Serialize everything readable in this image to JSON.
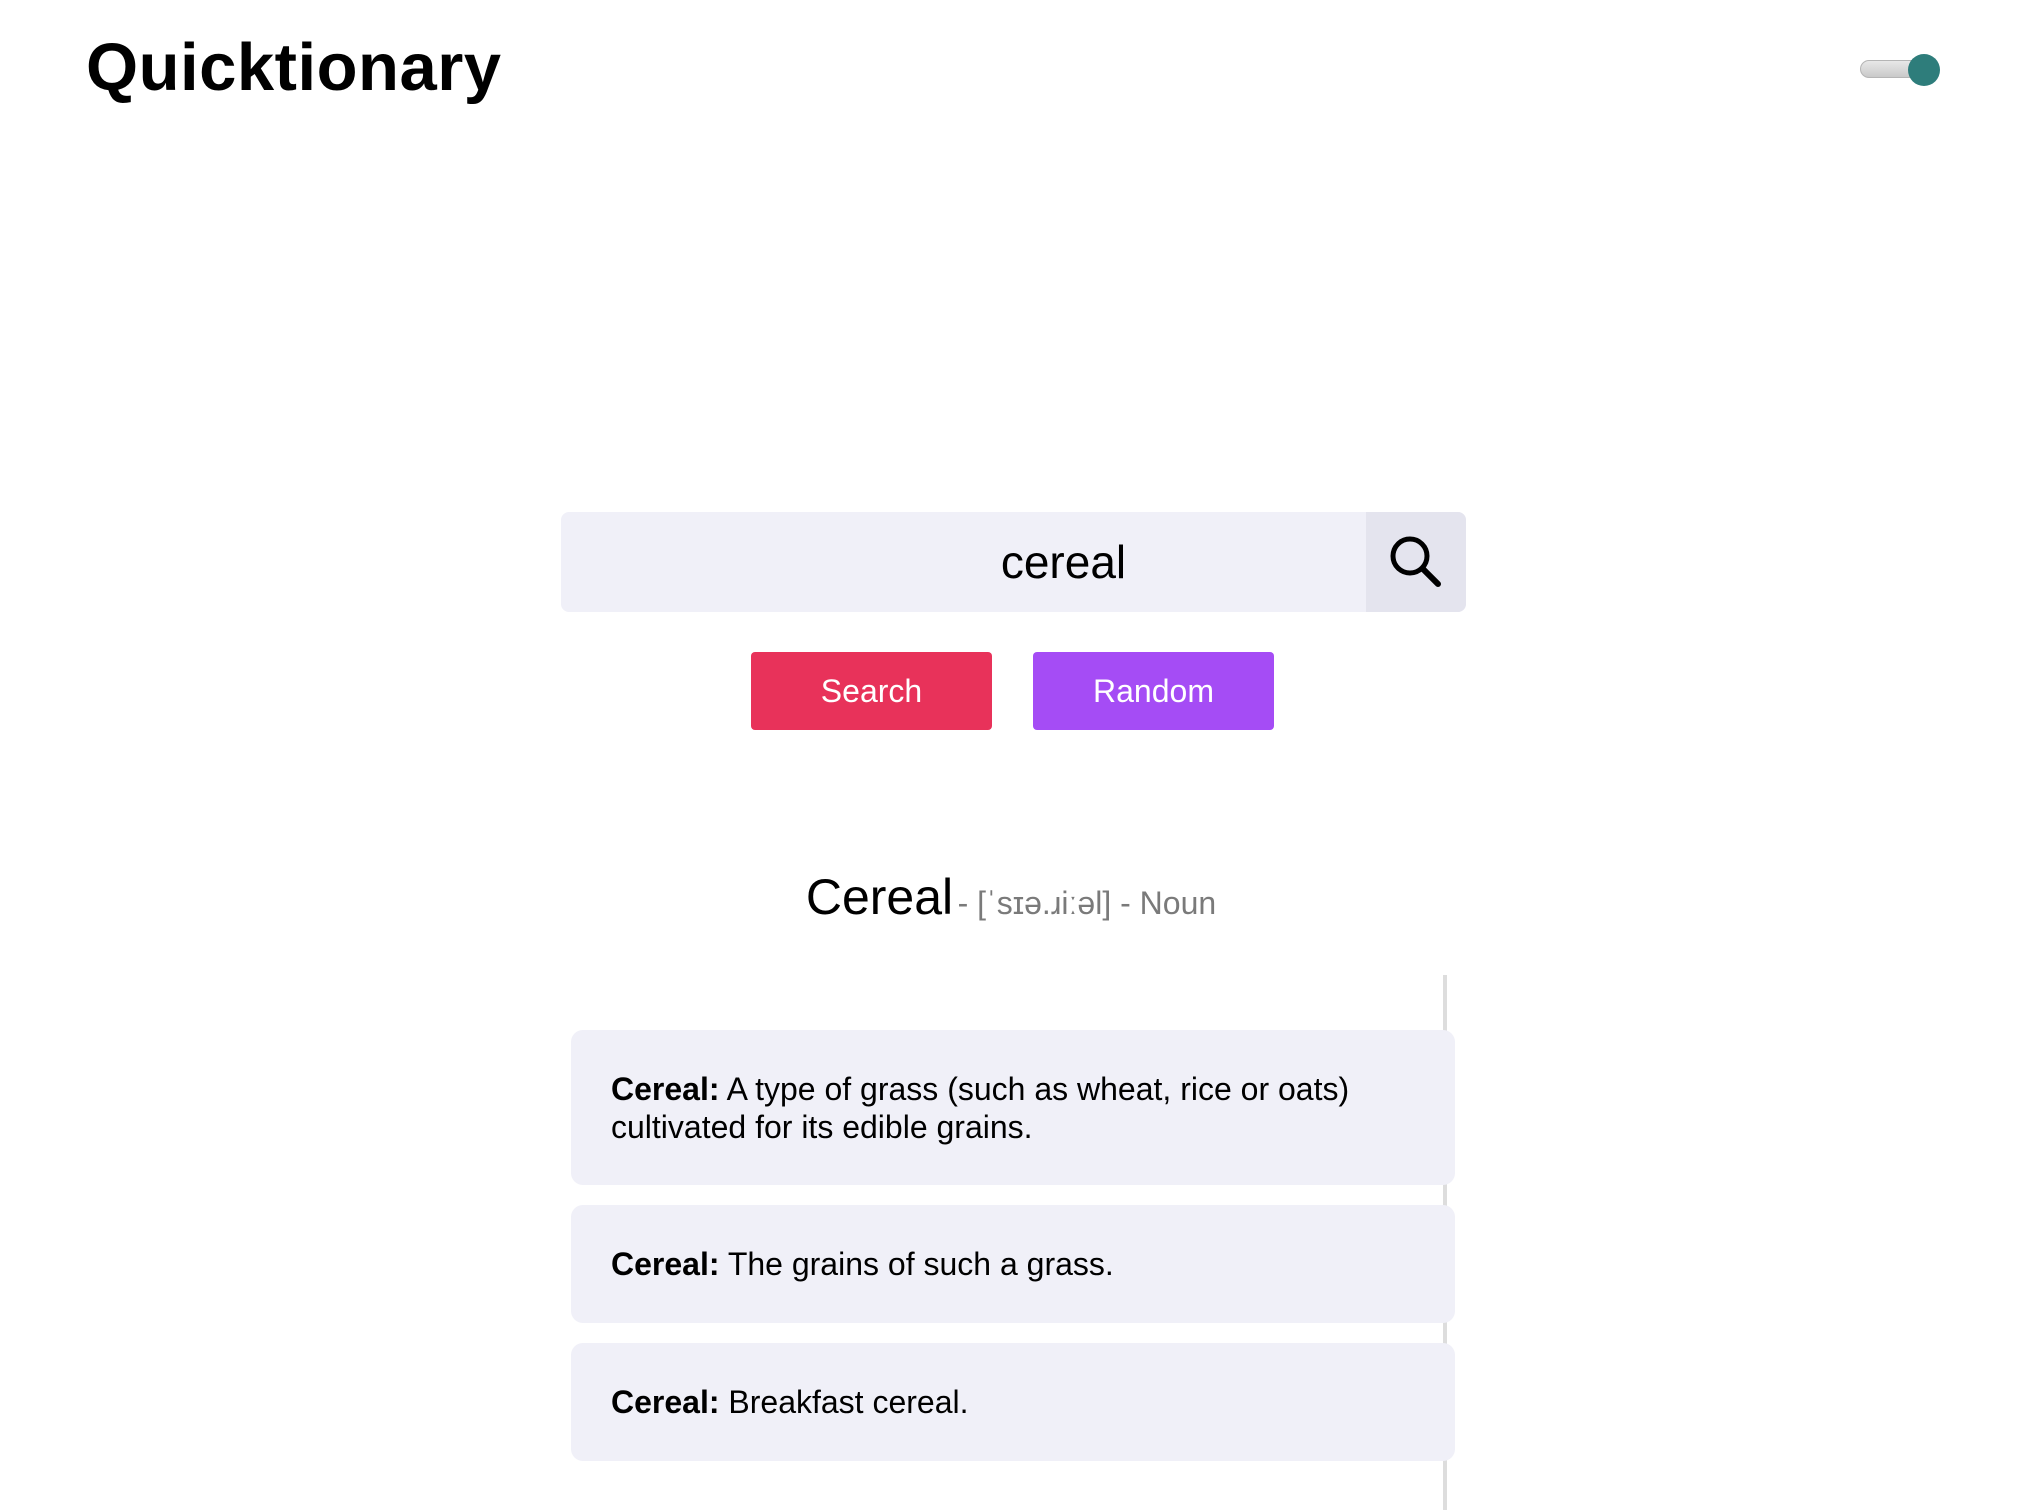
{
  "app": {
    "title": "Quicktionary"
  },
  "theme_toggle": {
    "state": "on",
    "knob_color": "#2e7d7b"
  },
  "search": {
    "value": "cereal",
    "icon": "search-icon"
  },
  "buttons": {
    "search_label": "Search",
    "random_label": "Random",
    "search_color": "#e8325a",
    "random_color": "#a54cf5"
  },
  "result": {
    "word": "Cereal",
    "meta": "- [ˈsɪə.ɹiːəl] - Noun",
    "definitions": [
      {
        "term": "Cereal:",
        "text": "A type of grass (such as wheat, rice or oats) cultivated for its edible grains."
      },
      {
        "term": "Cereal:",
        "text": "The grains of such a grass."
      },
      {
        "term": "Cereal:",
        "text": "Breakfast cereal."
      }
    ]
  }
}
